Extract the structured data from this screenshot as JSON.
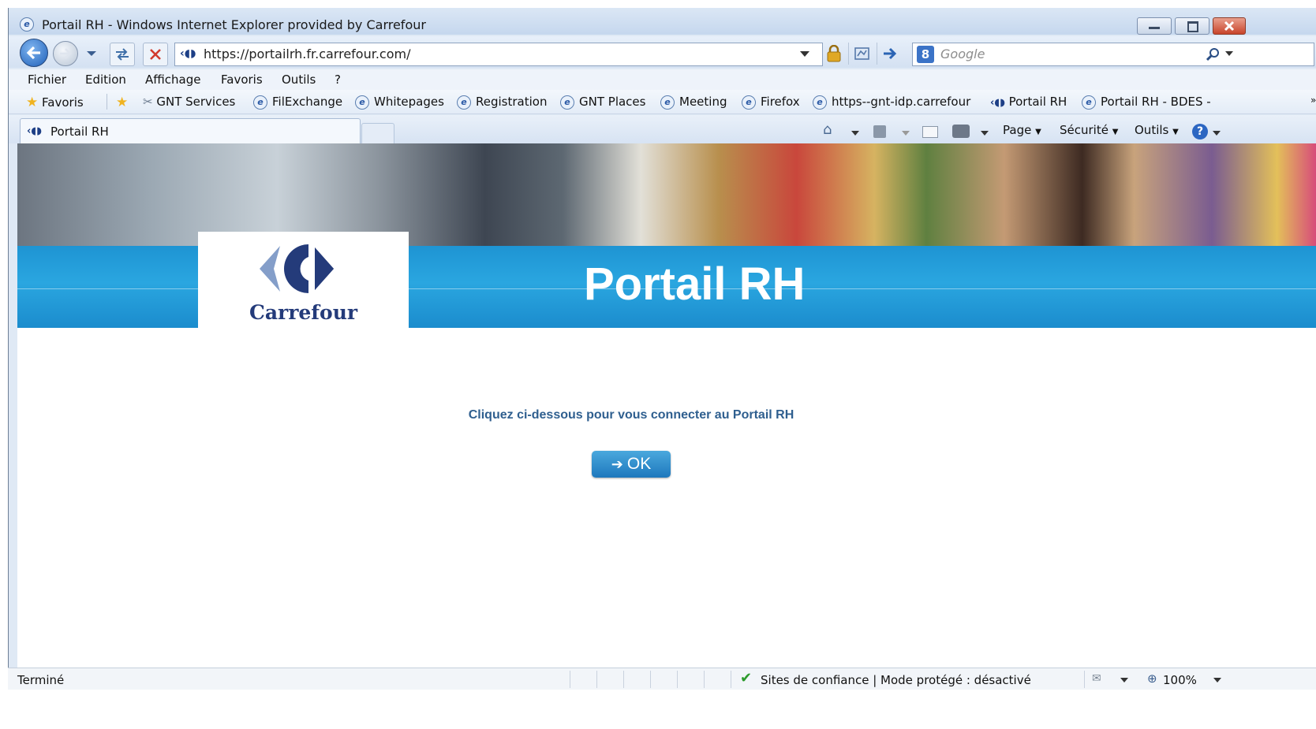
{
  "window": {
    "title": "Portail RH - Windows Internet Explorer provided by Carrefour"
  },
  "navbar": {
    "url": "https://portailrh.fr.carrefour.com/",
    "search_placeholder": "Google"
  },
  "menu": [
    "Fichier",
    "Edition",
    "Affichage",
    "Favoris",
    "Outils",
    "?"
  ],
  "favorites_bar": {
    "favorites_label": "Favoris",
    "items": [
      "GNT Services",
      "FilExchange",
      "Whitepages",
      "Registration",
      "GNT Places",
      "Meeting",
      "Firefox",
      "https--gnt-idp.carrefour",
      "Portail RH",
      "Portail RH - BDES -"
    ]
  },
  "tab": {
    "label": "Portail RH"
  },
  "command_bar": {
    "page": "Page",
    "security": "Sécurité",
    "tools": "Outils"
  },
  "page": {
    "logo_name": "Carrefour",
    "banner_title": "Portail RH",
    "prompt": "Cliquez ci-dessous pour vous connecter au Portail RH",
    "ok_label": "OK"
  },
  "status_bar": {
    "status": "Terminé",
    "zone": "Sites de confiance | Mode protégé : désactivé",
    "zoom": "100%"
  },
  "colors": {
    "banner_blue": "#1e94d3",
    "carrefour_navy": "#243b7a",
    "prompt_text": "#2f5f8f",
    "button_blue": "#1e78bd"
  },
  "icons": [
    "ie-icon",
    "back-arrow-icon",
    "forward-arrow-icon",
    "refresh-icon",
    "stop-icon",
    "lock-icon",
    "rss-icon",
    "go-arrow-icon",
    "search-icon",
    "star-icon",
    "home-icon",
    "feeds-icon",
    "mail-icon",
    "print-icon",
    "help-icon",
    "check-icon",
    "zoom-icon"
  ]
}
